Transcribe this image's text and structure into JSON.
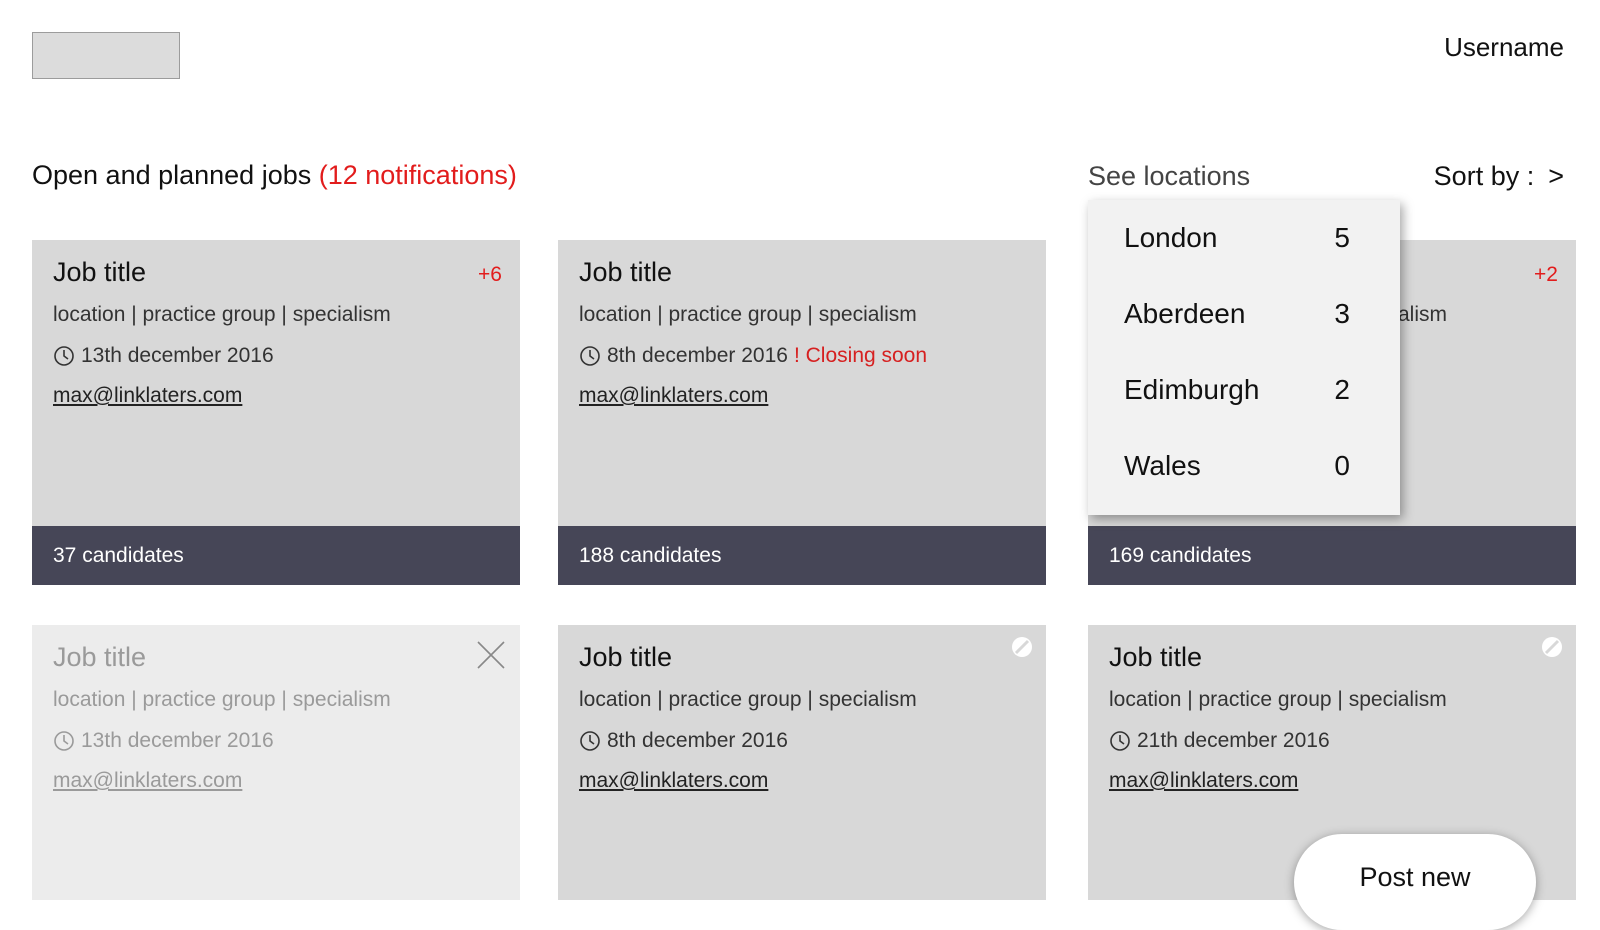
{
  "header": {
    "username": "Username"
  },
  "section": {
    "title": "Open and planned jobs",
    "notifications": "(12 notifications)",
    "see_locations": "See locations",
    "sort_by": "Sort by :",
    "sort_chevron": ">"
  },
  "locations_dropdown": [
    {
      "name": "London",
      "count": "5"
    },
    {
      "name": "Aberdeen",
      "count": "3"
    },
    {
      "name": "Edimburgh",
      "count": "2"
    },
    {
      "name": "Wales",
      "count": "0"
    }
  ],
  "cards": [
    {
      "title": "Job title",
      "meta": "location | practice group | specialism",
      "date": "13th december 2016",
      "closing": "",
      "email": "max@linklaters.com",
      "badge": "+6",
      "candidates": "37 candidates"
    },
    {
      "title": "Job title",
      "meta": "location | practice group | specialism",
      "date": "8th december 2016",
      "closing": "! Closing soon",
      "email": "max@linklaters.com",
      "badge": "",
      "candidates": "188 candidates"
    },
    {
      "title": "",
      "meta": "alism",
      "date": "",
      "closing": "",
      "email": "",
      "badge": "+2",
      "candidates": "169 candidates"
    },
    {
      "title": "Job title",
      "meta": "location | practice group | specialism",
      "date": "13th december 2016",
      "closing": "",
      "email": "max@linklaters.com",
      "badge": "",
      "candidates": ""
    },
    {
      "title": "Job title",
      "meta": "location | practice group | specialism",
      "date": "8th december 2016",
      "closing": "",
      "email": "max@linklaters.com",
      "badge": "",
      "candidates": ""
    },
    {
      "title": "Job title",
      "meta": "location | practice group | specialism",
      "date": "21th december 2016",
      "closing": "",
      "email": "max@linklaters.com",
      "badge": "",
      "candidates": ""
    }
  ],
  "actions": {
    "post_new": "Post new"
  },
  "colors": {
    "accent_red": "#e21c1c",
    "footer_bar": "#464657",
    "card_bg": "#d8d8d8"
  },
  "icons": {
    "clock": "clock-icon",
    "close": "close-icon",
    "edit": "edit-icon"
  }
}
